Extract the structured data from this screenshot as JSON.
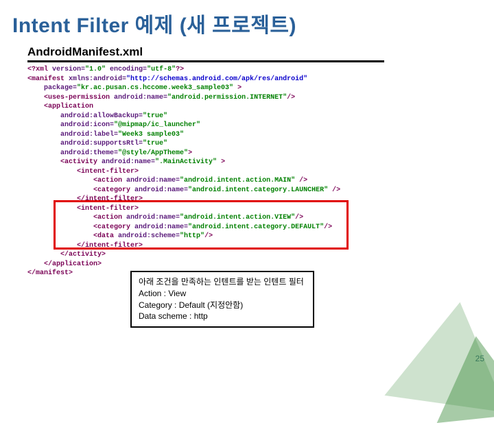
{
  "title": "Intent Filter 예제 (새 프로젝트)",
  "subtitle": "AndroidManifest.xml",
  "code": {
    "l1a": "<?xml",
    "l1b": " version=",
    "l1c": "\"1.0\"",
    "l1d": " encoding=",
    "l1e": "\"utf-8\"",
    "l1f": "?>",
    "l2a": "<manifest ",
    "l2b": "xmlns:android=",
    "l2c": "\"http://schemas.android.com/apk/res/android\"",
    "l3a": "    package=",
    "l3b": "\"kr.ac.pusan.cs.hccome.week3_sample03\"",
    "l3c": " >",
    "l4a": "    <uses-permission ",
    "l4b": "android:name=",
    "l4c": "\"android.permission.INTERNET\"",
    "l4d": "/>",
    "l5a": "    <application",
    "l6a": "        android:allowBackup=",
    "l6b": "\"true\"",
    "l7a": "        android:icon=",
    "l7b": "\"@mipmap/ic_launcher\"",
    "l8a": "        android:label=",
    "l8b": "\"Week3 sample03\"",
    "l9a": "        android:supportsRtl=",
    "l9b": "\"true\"",
    "l10a": "        android:theme=",
    "l10b": "\"@style/AppTheme\"",
    "l10c": ">",
    "l11a": "        <activity ",
    "l11b": "android:name=",
    "l11c": "\".MainActivity\"",
    "l11d": " >",
    "l12a": "            <intent-filter>",
    "l13a": "                <action ",
    "l13b": "android:name=",
    "l13c": "\"android.intent.action.MAIN\"",
    "l13d": " />",
    "l14a": "                <category ",
    "l14b": "android:name=",
    "l14c": "\"android.intent.category.LAUNCHER\"",
    "l14d": " />",
    "l15a": "            </intent-filter>",
    "l16a": "            <intent-filter>",
    "l17a": "                <action ",
    "l17b": "android:name=",
    "l17c": "\"android.intent.action.VIEW\"",
    "l17d": "/>",
    "l18a": "                <category ",
    "l18b": "android:name=",
    "l18c": "\"android.intent.category.DEFAULT\"",
    "l18d": "/>",
    "l19a": "                <data ",
    "l19b": "android:scheme=",
    "l19c": "\"http\"",
    "l19d": "/>",
    "l20a": "            </intent-filter>",
    "l21a": "        </activity>",
    "l22a": "    </application>",
    "l23a": "</manifest>"
  },
  "annotation": {
    "line1": "아래 조건을 만족하는 인텐트를 받는 인텐트 필터",
    "line2": "Action : View",
    "line3": "Category : Default (지정안함)",
    "line4": "Data scheme : http"
  },
  "page": "25"
}
